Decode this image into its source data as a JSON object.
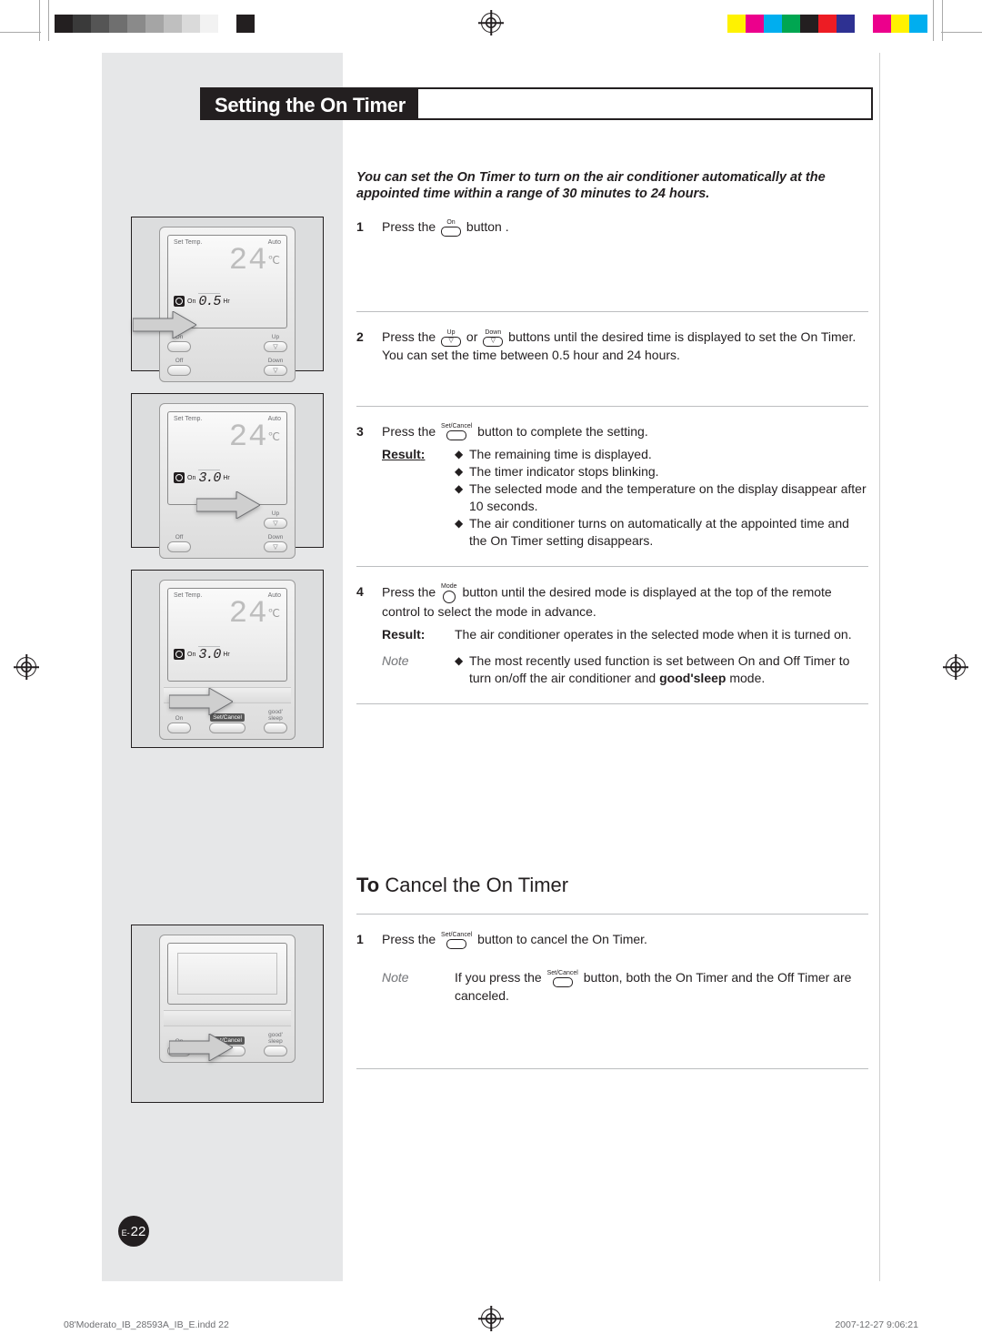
{
  "colorbar_left": [
    "#231f20",
    "#3a3a3a",
    "#555",
    "#6f6f6f",
    "#8a8a8a",
    "#a5a5a5",
    "#bfbfbf",
    "#dadada",
    "#f2f2f2",
    "#ffffff",
    "#231f20"
  ],
  "colorbar_right": [
    "#fff200",
    "#ec008c",
    "#00aeef",
    "#00a651",
    "#231f20",
    "#ed1c24",
    "#2e3192",
    "#ffffff",
    "#ec008c",
    "#fff200",
    "#00aeef"
  ],
  "title": "Setting the On Timer",
  "intro": "You can set the On Timer to turn on the air conditioner automatically at the appointed time within a range of 30 minutes to 24 hours.",
  "btn_on": "On",
  "btn_up": "Up",
  "btn_down": "Down",
  "btn_setcancel": "Set/Cancel",
  "btn_mode": "Mode",
  "steps": {
    "s1": {
      "num": "1",
      "a": "Press the ",
      "b": " button ."
    },
    "s2": {
      "num": "2",
      "a": "Press the ",
      "b": " or ",
      "c": " buttons until the desired time is displayed to set the On Timer. You can set the time between 0.5 hour and 24 hours."
    },
    "s3": {
      "num": "3",
      "a": "Press the ",
      "b": " button to complete the setting.",
      "result_lbl": "Result",
      "r1": "The remaining time is displayed.",
      "r2": "The timer indicator stops blinking.",
      "r3": " The selected mode and the temperature on the display disappear after 10 seconds.",
      "r4": "The air conditioner turns on automatically at the appointed time and the On Timer setting disappears."
    },
    "s4": {
      "num": "4",
      "a": "Press the ",
      "b": " button until the desired mode is displayed at the top of the remote control to select the mode in advance.",
      "result_lbl": "Result",
      "result_txt": "The air conditioner operates in the selected mode when it is turned on.",
      "note_lbl": "Note",
      "note_a": "The most recently used function is set between On and Off Timer to turn on/off the air conditioner and ",
      "note_bold": "good'sleep",
      "note_b": " mode."
    }
  },
  "h2_a": "To",
  "h2_b": " Cancel the On Timer",
  "cancel": {
    "num": "1",
    "a": "Press the ",
    "b": " button to cancel the On Timer.",
    "note_lbl": "Note",
    "note_a": "If you press the ",
    "note_b": " button, both the On Timer and the Off Timer are canceled."
  },
  "fig": {
    "settemp": "Set Temp.",
    "auto": "Auto",
    "temp": "24",
    "unit": "℃",
    "t1": "0.5",
    "t2": "3.0",
    "t3": "3.0",
    "hr": "Hr",
    "on_lbl": "On",
    "on": "On",
    "off": "Off",
    "up": "Up",
    "down": "Down",
    "setcancel": "Set/Cancel",
    "goodsleep_a": "good'",
    "goodsleep_b": "sleep"
  },
  "page_e": "E-",
  "page_n": "22",
  "footer_left": "08'Moderato_IB_28593A_IB_E.indd   22",
  "footer_right": "2007-12-27   9:06:21"
}
